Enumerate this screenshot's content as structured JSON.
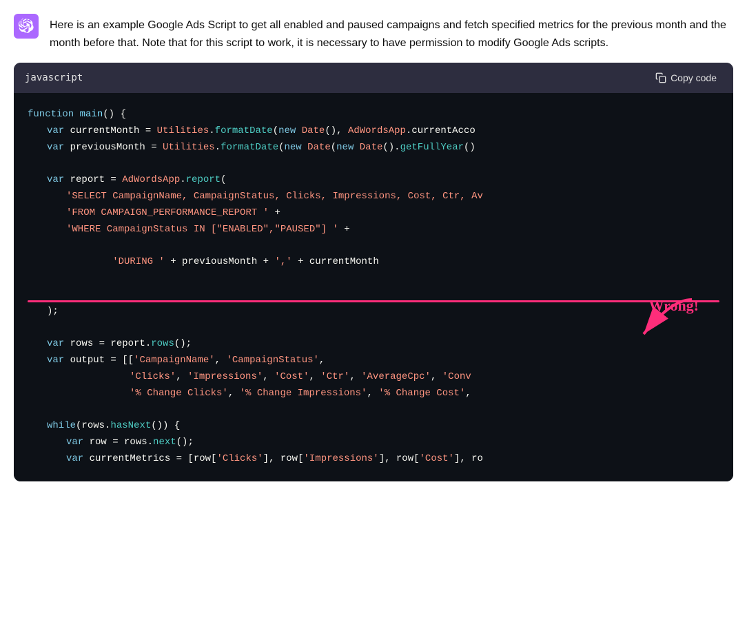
{
  "header": {
    "avatar_alt": "OpenAI logo",
    "message": "Here is an example Google Ads Script to get all enabled and paused campaigns and fetch specified metrics for the previous month and the month before that. Note that for this script to work, it is necessary to have permission to modify Google Ads scripts."
  },
  "code_block": {
    "language": "javascript",
    "copy_label": "Copy code",
    "lines": [
      "function main() {",
      "  var currentMonth = Utilities.formatDate(new Date(), AdWordsApp.currentAcco",
      "  var previousMonth = Utilities.formatDate(new Date(new Date().getFullYear()",
      "",
      "  var report = AdWordsApp.report(",
      "    'SELECT CampaignName, CampaignStatus, Clicks, Impressions, Cost, Ctr, Av",
      "    'FROM CAMPAIGN_PERFORMANCE_REPORT ' +",
      "    'WHERE CampaignStatus IN [\"ENABLED\",\"PAUSED\"] ' +",
      "    'DURING ' + previousMonth + ',' + currentMonth",
      "  );",
      "",
      "  var rows = report.rows();",
      "  var output = [['CampaignName', 'CampaignStatus',",
      "                  'Clicks', 'Impressions', 'Cost', 'Ctr', 'AverageCpc', 'Conv",
      "                  '% Change Clicks', '% Change Impressions', '% Change Cost',",
      "",
      "  while(rows.hasNext()) {",
      "    var row = rows.next();",
      "    var currentMetrics = [row['Clicks'], row['Impressions'], row['Cost'], ro"
    ]
  },
  "annotation": {
    "wrong_text": "Wrong!"
  }
}
